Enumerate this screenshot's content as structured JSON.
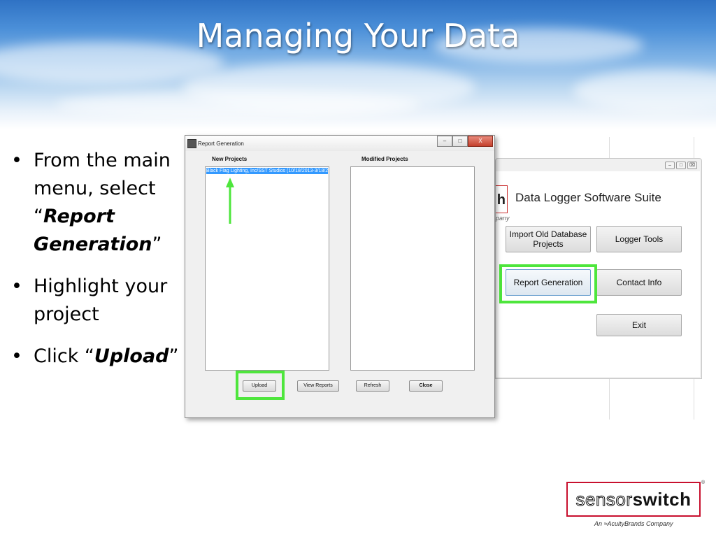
{
  "slide": {
    "title": "Managing Your Data",
    "bullets": [
      {
        "pre": "From the main menu, select “",
        "em": "Report Generation",
        "post": "”"
      },
      {
        "pre": "Highlight your project",
        "em": "",
        "post": ""
      },
      {
        "pre": "Click “",
        "em": "Upload",
        "post": "”"
      }
    ],
    "bullet_symbol": "•"
  },
  "main_menu": {
    "title": "Data Logger Software Suite",
    "logo_fragment": "h",
    "company_fragment": "pany",
    "buttons": {
      "import": "Import Old Database Projects",
      "logger_tools": "Logger Tools",
      "report_generation": "Report Generation",
      "contact_info": "Contact Info",
      "exit": "Exit"
    }
  },
  "report_window": {
    "title": "Report Generation",
    "new_projects_label": "New Projects",
    "modified_projects_label": "Modified Projects",
    "selected_project": "Black Flag Lighting, Inc/SST Studios (10/18/2013-3/18/2",
    "buttons": {
      "upload": "Upload",
      "view_reports": "View Reports",
      "refresh": "Refresh",
      "close": "Close"
    },
    "window_controls": {
      "minimize": "–",
      "maximize": "□",
      "close": "X"
    }
  },
  "branding": {
    "logo_light": "sensor",
    "logo_heavy": "switch",
    "registered": "®",
    "tagline": "An ≈AcuityBrands Company",
    "accent_color": "#c8102e"
  },
  "colors": {
    "highlight_green": "#4ee63c",
    "selection_blue": "#3399ff"
  },
  "icons": [
    "report-window-icon",
    "arrow-up-icon",
    "minimize-icon",
    "maximize-icon",
    "close-icon"
  ]
}
